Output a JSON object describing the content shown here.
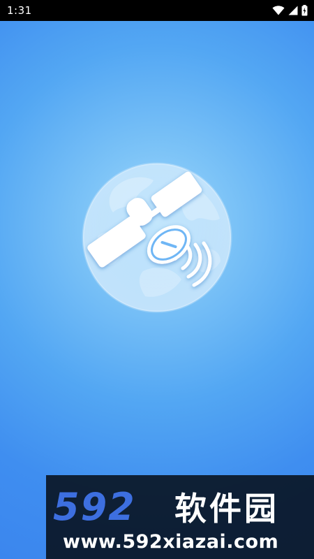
{
  "status_bar": {
    "time": "1:31",
    "icons": [
      "wifi-icon",
      "signal-icon",
      "battery-icon"
    ]
  },
  "splash": {
    "logo_icon": "satellite-globe-icon",
    "colors": {
      "background_center": "#9fd7fb",
      "background_edge": "#3b86ee",
      "logo_white": "#ffffff"
    }
  },
  "watermark": {
    "number": "592",
    "chinese": "软件园",
    "url": "www.592xiazai.com",
    "colors": {
      "number": "#3d6fe0",
      "background": "#111111"
    }
  }
}
